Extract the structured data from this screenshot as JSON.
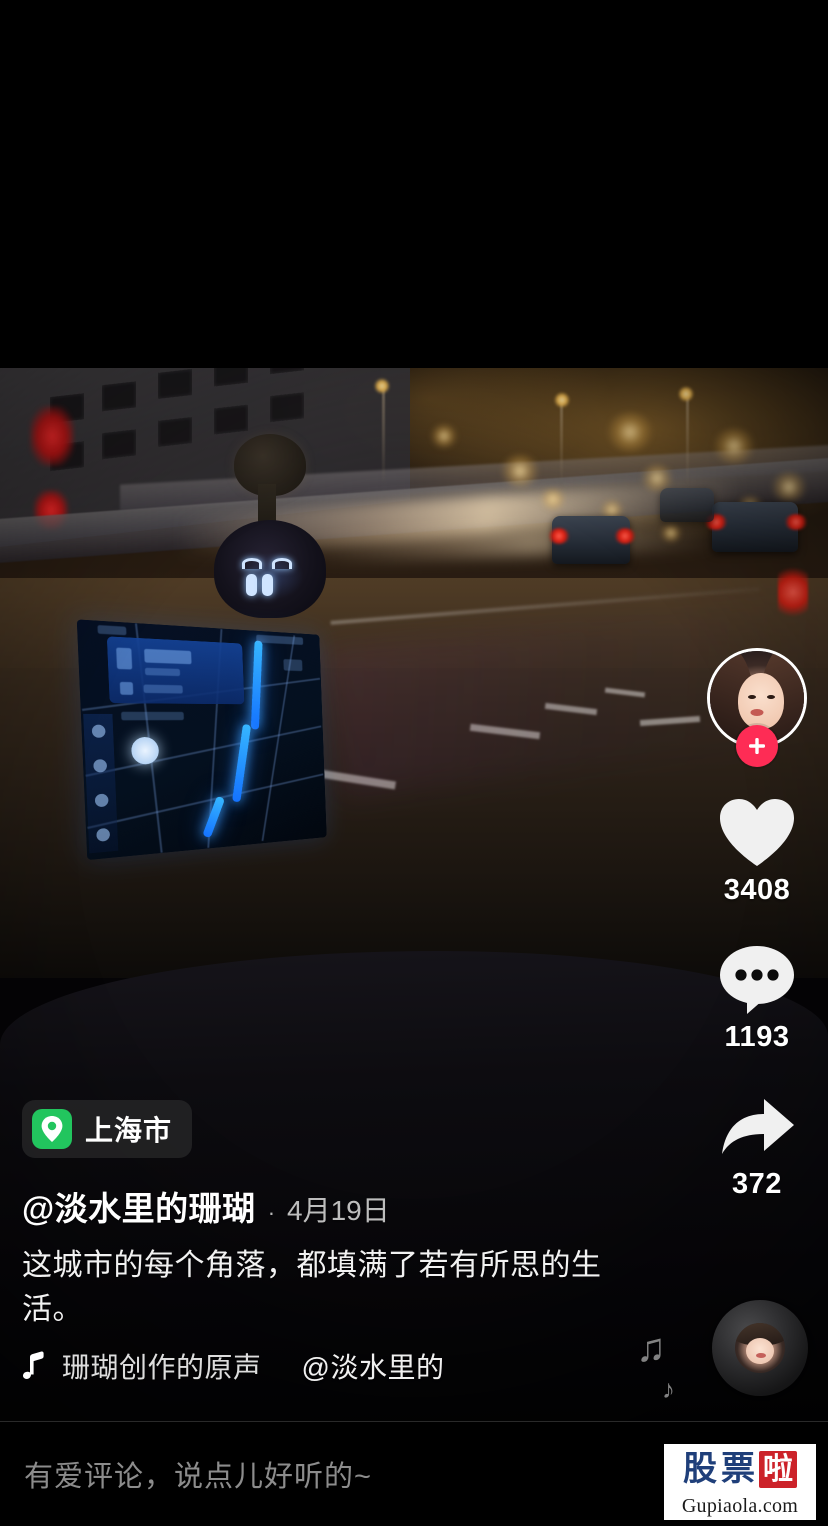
{
  "app": {
    "name": "douyin-video-player"
  },
  "video": {
    "scene_description": "night-city-driving-dashcam",
    "location_badge": {
      "icon": "location-pin-icon",
      "label": "上海市"
    }
  },
  "author": {
    "handle": "@淡水里的珊瑚",
    "separator": "·",
    "date": "4月19日",
    "avatar_alt": "author-avatar",
    "follow_icon": "plus-icon"
  },
  "caption": {
    "text": "这城市的每个角落，都填满了若有所思的生活。"
  },
  "music": {
    "icon": "music-note-icon",
    "title": "珊瑚创作的原声",
    "attribution": "@淡水里的",
    "disc_alt": "album-cover",
    "note_glyph_1": "♪",
    "note_glyph_2": "♫"
  },
  "actions": [
    {
      "name": "like",
      "icon": "heart-icon",
      "count": "3408"
    },
    {
      "name": "comment",
      "icon": "comment-bubble-icon",
      "count": "1193"
    },
    {
      "name": "share",
      "icon": "share-arrow-icon",
      "count": "372"
    }
  ],
  "comment_bar": {
    "placeholder": "有爱评论，说点儿好听的~",
    "mention_icon": "at-icon"
  },
  "watermark": {
    "char1": "股",
    "char2": "票",
    "char3": "啦",
    "url": "Gupiaola.com"
  },
  "colors": {
    "accent_red": "#fe2c55",
    "location_green": "#22c55e",
    "background": "#000000",
    "text_primary": "#ffffff",
    "text_muted": "#8c8c8c"
  }
}
